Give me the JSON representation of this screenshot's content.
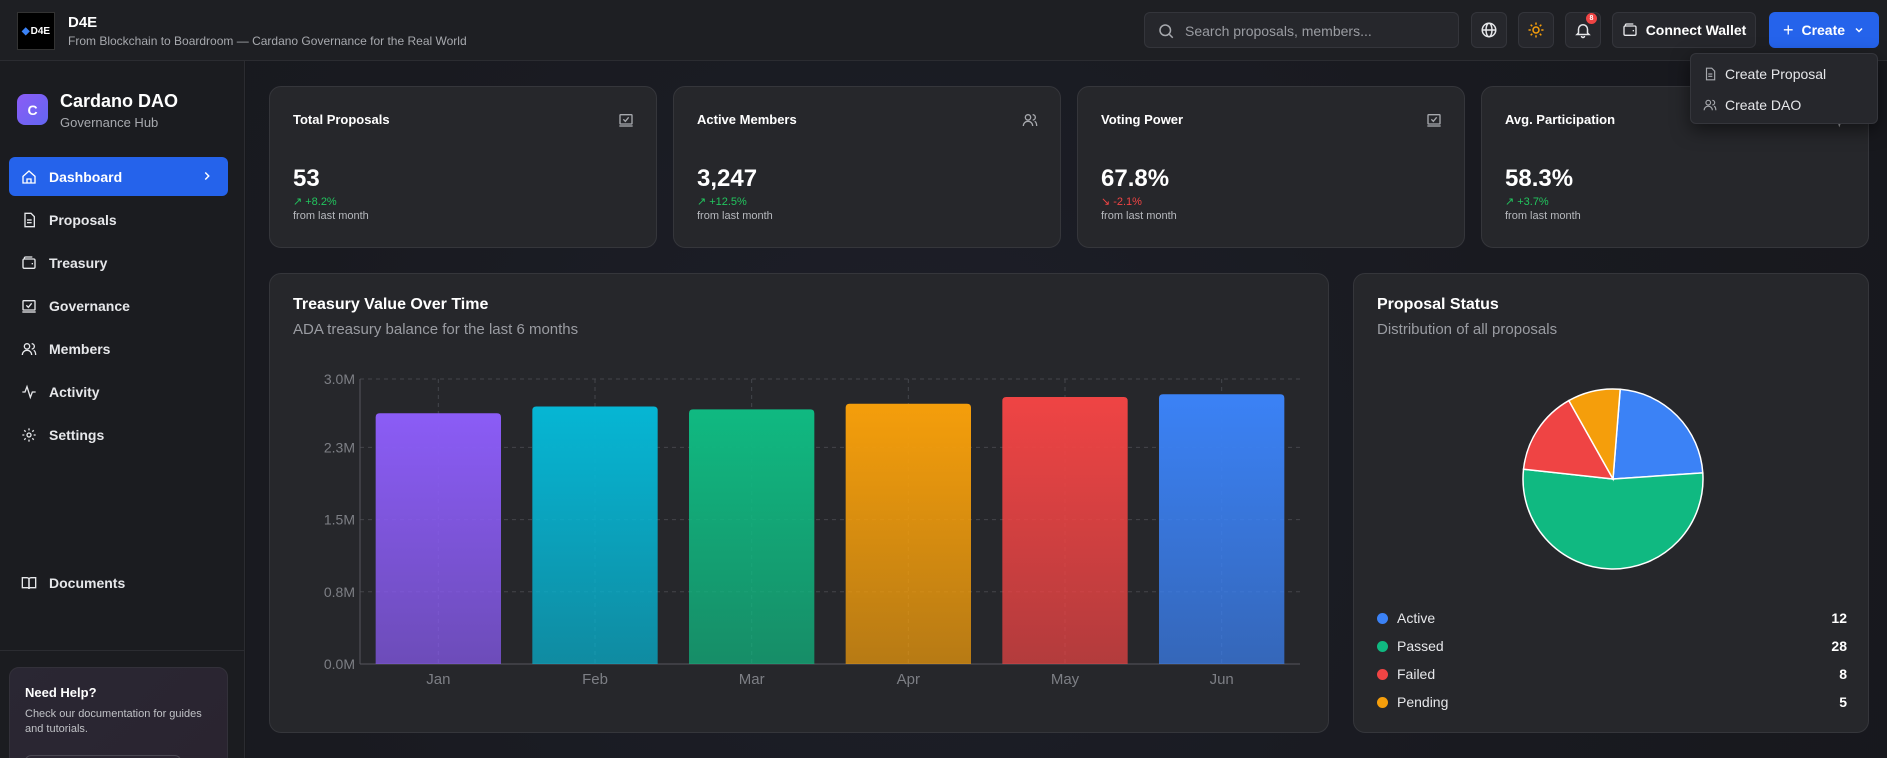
{
  "brand": {
    "logo_text": "D4E",
    "name": "D4E",
    "tagline": "From Blockchain to Boardroom — Cardano Governance for the Real World"
  },
  "search": {
    "placeholder": "Search proposals, members..."
  },
  "header": {
    "notification_count": "8",
    "connect_wallet_label": "Connect Wallet",
    "create_label": "Create",
    "create_menu": [
      "Create Proposal",
      "Create DAO"
    ]
  },
  "org": {
    "initial": "C",
    "name": "Cardano DAO",
    "subtitle": "Governance Hub"
  },
  "nav": {
    "items": [
      {
        "label": "Dashboard",
        "icon": "home-icon"
      },
      {
        "label": "Proposals",
        "icon": "document-icon"
      },
      {
        "label": "Treasury",
        "icon": "wallet-icon"
      },
      {
        "label": "Governance",
        "icon": "vote-icon"
      },
      {
        "label": "Members",
        "icon": "users-icon"
      },
      {
        "label": "Activity",
        "icon": "activity-icon"
      },
      {
        "label": "Settings",
        "icon": "gear-icon"
      }
    ],
    "documents_label": "Documents"
  },
  "help": {
    "title": "Need Help?",
    "text": "Check our documentation for guides and tutorials."
  },
  "stats": [
    {
      "title": "Total Proposals",
      "value": "53",
      "change": "+8.2%",
      "trend": "up",
      "note": "from last month"
    },
    {
      "title": "Active Members",
      "value": "3,247",
      "change": "+12.5%",
      "trend": "up",
      "note": "from last month"
    },
    {
      "title": "Voting Power",
      "value": "67.8%",
      "change": "-2.1%",
      "trend": "down",
      "note": "from last month"
    },
    {
      "title": "Avg. Participation",
      "value": "58.3%",
      "change": "+3.7%",
      "trend": "up",
      "note": "from last month"
    }
  ],
  "treasury": {
    "title": "Treasury Value Over Time",
    "subtitle": "ADA treasury balance for the last 6 months"
  },
  "proposal_status": {
    "title": "Proposal Status",
    "subtitle": "Distribution of all proposals"
  },
  "colors": {
    "accent": "#2563eb",
    "up": "#22c55e",
    "down": "#ef4444"
  },
  "chart_data": [
    {
      "type": "bar",
      "title": "Treasury Value Over Time",
      "subtitle": "ADA treasury balance for the last 6 months",
      "categories": [
        "Jan",
        "Feb",
        "Mar",
        "Apr",
        "May",
        "Jun"
      ],
      "values": [
        2640000,
        2710000,
        2680000,
        2740000,
        2810000,
        2840000
      ],
      "bar_colors": [
        "#8b5cf6",
        "#06b6d4",
        "#10b981",
        "#f59e0b",
        "#ef4444",
        "#3b82f6"
      ],
      "ytick_values": [
        0,
        760000,
        1520000,
        2280000,
        3000000
      ],
      "ytick_labels": [
        "0.0M",
        "0.8M",
        "1.5M",
        "2.3M",
        "3.0M"
      ],
      "ylim": [
        0,
        3000000
      ],
      "grid": true
    },
    {
      "type": "pie",
      "title": "Proposal Status",
      "subtitle": "Distribution of all proposals",
      "labels": [
        "Active",
        "Passed",
        "Failed",
        "Pending"
      ],
      "values": [
        12,
        28,
        8,
        5
      ],
      "colors": [
        "#3b82f6",
        "#10b981",
        "#ef4444",
        "#f59e0b"
      ]
    }
  ]
}
